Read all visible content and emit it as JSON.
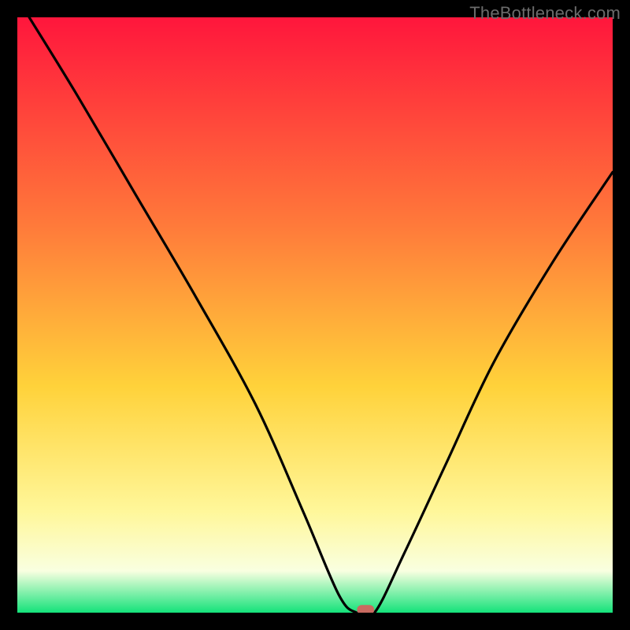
{
  "watermark": "TheBottleneck.com",
  "chart_data": {
    "type": "line",
    "title": "",
    "xlabel": "",
    "ylabel": "",
    "xlim": [
      0,
      100
    ],
    "ylim": [
      0,
      100
    ],
    "grid": false,
    "series": [
      {
        "name": "curve",
        "x": [
          2,
          10,
          20,
          30,
          40,
          48,
          54,
          57,
          60,
          65,
          72,
          80,
          90,
          100
        ],
        "values": [
          100,
          87,
          70,
          53,
          35,
          17,
          3,
          0,
          0,
          10,
          25,
          42,
          59,
          74
        ]
      }
    ],
    "marker": {
      "x": 58.5,
      "y": 0.5
    },
    "colors": {
      "gradient_top": "#ff163c",
      "gradient_mid_upper": "#ff7a3a",
      "gradient_mid": "#ffd23a",
      "gradient_lower": "#fff79a",
      "gradient_band": "#f9ffe0",
      "gradient_bottom": "#14e27a",
      "curve": "#000000",
      "marker": "#c96a60"
    }
  }
}
